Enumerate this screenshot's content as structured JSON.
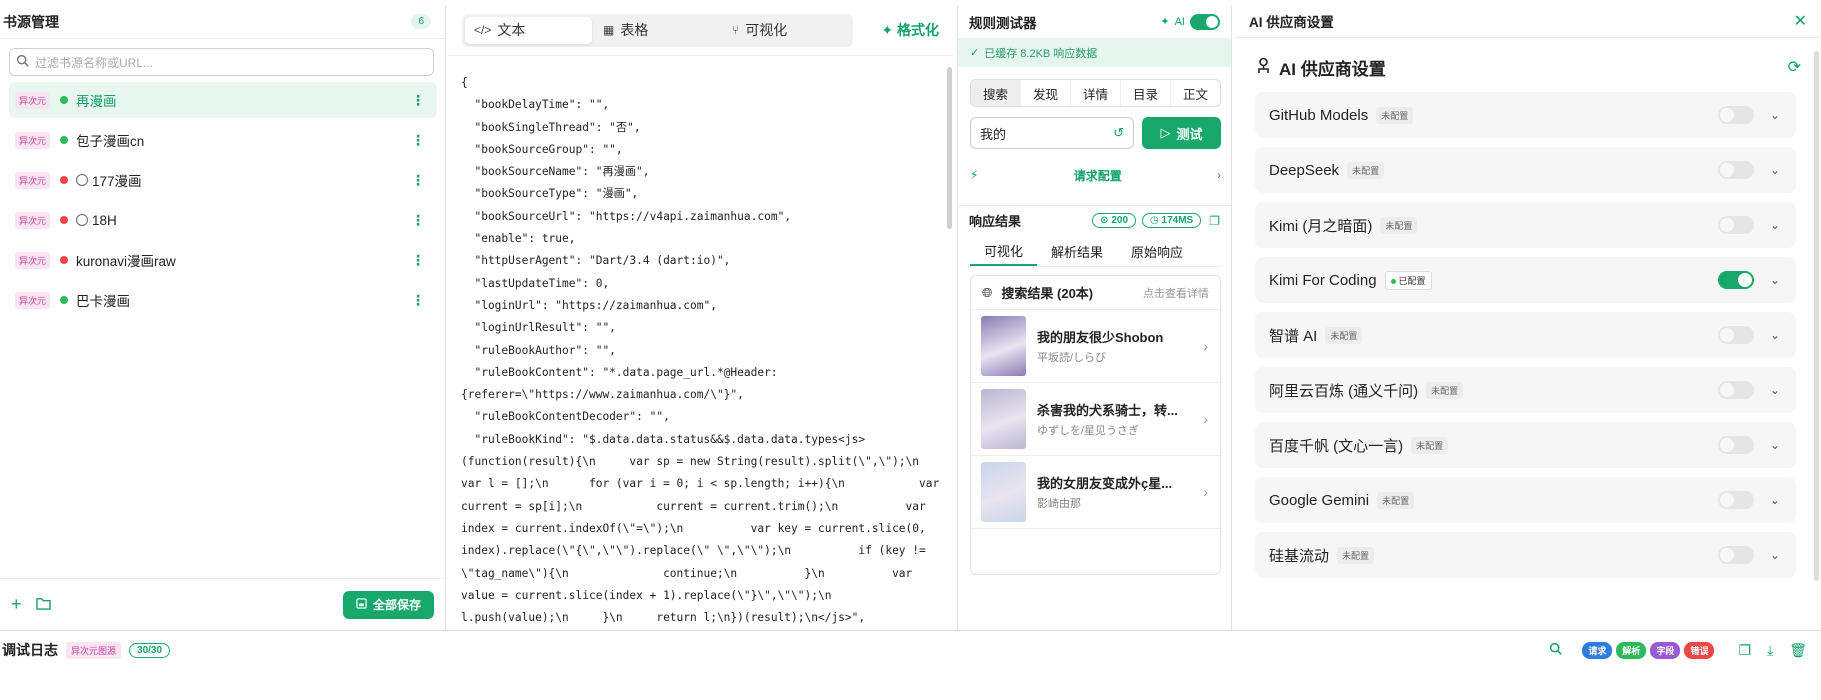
{
  "sources": {
    "title": "书源管理",
    "count": "6",
    "search_placeholder": "过滤书源名称或URL...",
    "items": [
      {
        "tag": "异次元",
        "name": "再漫画",
        "status": "green",
        "active": true,
        "circle": false
      },
      {
        "tag": "异次元",
        "name": "包子漫画cn",
        "status": "green",
        "active": false,
        "circle": false
      },
      {
        "tag": "异次元",
        "name": "177漫画",
        "status": "red",
        "active": false,
        "circle": true
      },
      {
        "tag": "异次元",
        "name": "18H",
        "status": "red",
        "active": false,
        "circle": true
      },
      {
        "tag": "异次元",
        "name": "kuronavi漫画raw",
        "status": "red",
        "active": false,
        "circle": false
      },
      {
        "tag": "异次元",
        "name": "巴卡漫画",
        "status": "green",
        "active": false,
        "circle": false
      }
    ],
    "save_all": "全部保存"
  },
  "editor": {
    "tabs": [
      {
        "label": "文本",
        "icon": "code-icon"
      },
      {
        "label": "表格",
        "icon": "table-icon"
      },
      {
        "label": "可视化",
        "icon": "branch-icon"
      }
    ],
    "format_label": "格式化",
    "code": "{\n  \"bookDelayTime\": \"\",\n  \"bookSingleThread\": \"否\",\n  \"bookSourceGroup\": \"\",\n  \"bookSourceName\": \"再漫画\",\n  \"bookSourceType\": \"漫画\",\n  \"bookSourceUrl\": \"https://v4api.zaimanhua.com\",\n  \"enable\": true,\n  \"httpUserAgent\": \"Dart/3.4 (dart:io)\",\n  \"lastUpdateTime\": 0,\n  \"loginUrl\": \"https://zaimanhua.com\",\n  \"loginUrlResult\": \"\",\n  \"ruleBookAuthor\": \"\",\n  \"ruleBookContent\": \"*.data.page_url.*@Header:\n{referer=\\\"https://www.zaimanhua.com/\\\"}\",\n  \"ruleBookContentDecoder\": \"\",\n  \"ruleBookKind\": \"$.data.data.status&&$.data.data.types<js>\n(function(result){\\n     var sp = new String(result).split(\\\",\\\");\\n\nvar l = [];\\n      for (var i = 0; i < sp.length; i++){\\n           var\ncurrent = sp[i];\\n           current = current.trim();\\n          var\nindex = current.indexOf(\\\"=\\\");\\n          var key = current.slice(0,\nindex).replace(\\\"{\\\",\\\"\\\").replace(\\\" \\\",\\\"\\\");\\n          if (key !=\n\\\"tag_name\\\"){\\n              continue;\\n          }\\n          var\nvalue = current.slice(index + 1).replace(\\\"}\\\",\\\"\\\");\\n\nl.push(value);\\n     }\\n     return l;\\n})(result);\\n</js>\","
  },
  "tester": {
    "title": "规则测试器",
    "ai_label": "AI",
    "cache_text": "已缓存 8.2KB 响应数据",
    "tabs": [
      "搜索",
      "发现",
      "详情",
      "目录",
      "正文"
    ],
    "keyword": "我的",
    "test_button": "测试",
    "request_config": "请求配置",
    "response_title": "响应结果",
    "status_code": "200",
    "time": "174MS",
    "result_tabs": [
      "可视化",
      "解析结果",
      "原始响应"
    ],
    "results_title": "搜索结果 (20本)",
    "results_hint": "点击查看详情",
    "books": [
      {
        "title": "我的朋友很少Shobon",
        "author": "平坂読/しらび",
        "cover": "#8a7bb5"
      },
      {
        "title": "杀害我的犬系骑士，转...",
        "author": "ゆずしを/星见うさぎ",
        "cover": "#b9b6cf"
      },
      {
        "title": "我的女朋友变成外ç星...",
        "author": "影崎由那",
        "cover": "#c8d6ea"
      }
    ]
  },
  "providers": {
    "panel_title": "AI 供应商设置",
    "title": "AI 供应商设置",
    "items": [
      {
        "name": "GitHub Models",
        "status": "未配置",
        "enabled": false
      },
      {
        "name": "DeepSeek",
        "status": "未配置",
        "enabled": false
      },
      {
        "name": "Kimi (月之暗面)",
        "status": "未配置",
        "enabled": false
      },
      {
        "name": "Kimi For Coding",
        "status": "已配置",
        "enabled": true
      },
      {
        "name": "智谱 AI",
        "status": "未配置",
        "enabled": false
      },
      {
        "name": "阿里云百炼 (通义千问)",
        "status": "未配置",
        "enabled": false
      },
      {
        "name": "百度千帆 (文心一言)",
        "status": "未配置",
        "enabled": false
      },
      {
        "name": "Google Gemini",
        "status": "未配置",
        "enabled": false
      },
      {
        "name": "硅基流动",
        "status": "未配置",
        "enabled": false
      }
    ]
  },
  "log": {
    "title": "调试日志",
    "tag": "异次元图源",
    "count": "30/30",
    "chips": [
      {
        "label": "请求",
        "color": "#2f7de1"
      },
      {
        "label": "解析",
        "color": "#2cbb5b"
      },
      {
        "label": "字段",
        "color": "#9b59d6"
      },
      {
        "label": "错误",
        "color": "#ef4545"
      }
    ]
  }
}
